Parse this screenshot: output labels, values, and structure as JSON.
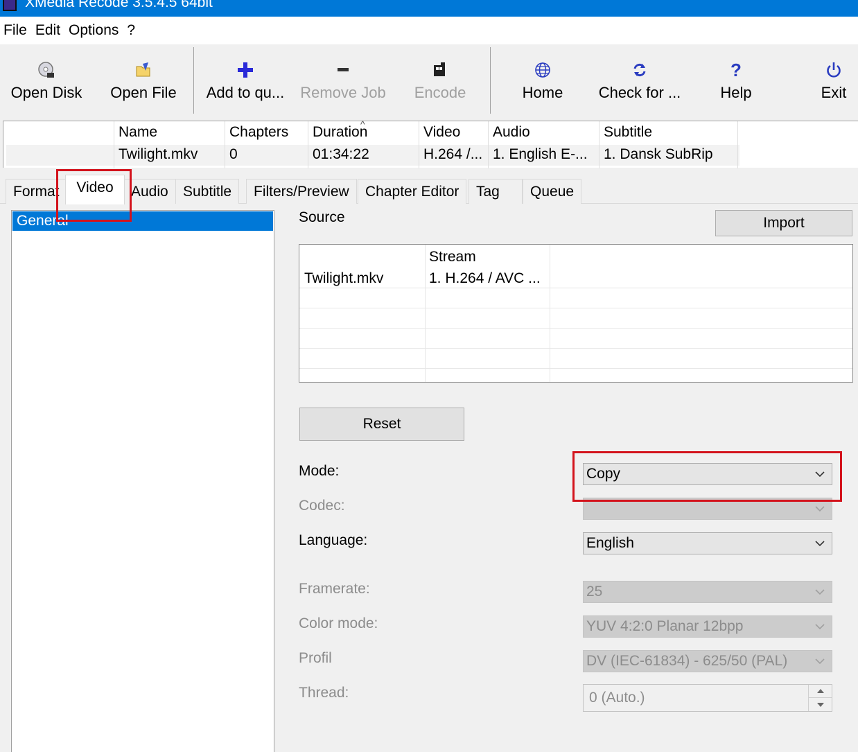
{
  "window": {
    "title": "XMedia Recode 3.5.4.5 64bit"
  },
  "menu": [
    "File",
    "Edit",
    "Options",
    "?"
  ],
  "toolbar": [
    {
      "label": "Open Disk",
      "icon": "disk-icon",
      "enabled": true
    },
    {
      "label": "Open File",
      "icon": "open-file-icon",
      "enabled": true
    },
    {
      "label": "Add to qu...",
      "icon": "plus-icon",
      "enabled": true
    },
    {
      "label": "Remove Job",
      "icon": "minus-icon",
      "enabled": false
    },
    {
      "label": "Encode",
      "icon": "encode-icon",
      "enabled": false
    },
    {
      "label": "Home",
      "icon": "globe-icon",
      "enabled": true
    },
    {
      "label": "Check for ...",
      "icon": "refresh-icon",
      "enabled": true
    },
    {
      "label": "Help",
      "icon": "question-icon",
      "enabled": true
    },
    {
      "label": "Exit",
      "icon": "power-icon",
      "enabled": true
    }
  ],
  "joblist": {
    "columns": [
      "Name",
      "Chapters",
      "Duration",
      "Video",
      "Audio",
      "Subtitle"
    ],
    "rows": [
      [
        "Twilight.mkv",
        "0",
        "01:34:22",
        "H.264 /...",
        "1. English E-...",
        "1. Dansk SubRip"
      ]
    ]
  },
  "tabs": [
    "Format",
    "Video",
    "Audio",
    "Subtitle",
    "Filters/Preview",
    "Chapter Editor",
    "Tag",
    "Queue"
  ],
  "active_tab": "Video",
  "tree": {
    "selected": "General"
  },
  "source": {
    "label": "Source",
    "import_label": "Import",
    "stream_header": "Stream",
    "rows": [
      {
        "file": "Twilight.mkv",
        "stream": "1. H.264 / AVC ..."
      }
    ]
  },
  "reset_label": "Reset",
  "settings": {
    "mode": {
      "label": "Mode:",
      "value": "Copy"
    },
    "codec": {
      "label": "Codec:",
      "value": ""
    },
    "language": {
      "label": "Language:",
      "value": "English"
    },
    "framerate": {
      "label": "Framerate:",
      "value": "25"
    },
    "color_mode": {
      "label": "Color mode:",
      "value": "YUV 4:2:0 Planar 12bpp"
    },
    "profile": {
      "label": "Profil",
      "value": "DV (IEC-61834) - 625/50 (PAL)"
    },
    "thread": {
      "label": "Thread:",
      "value": "0 (Auto.)"
    }
  },
  "colors": {
    "accent": "#0078d7",
    "highlight": "#d3131c"
  }
}
